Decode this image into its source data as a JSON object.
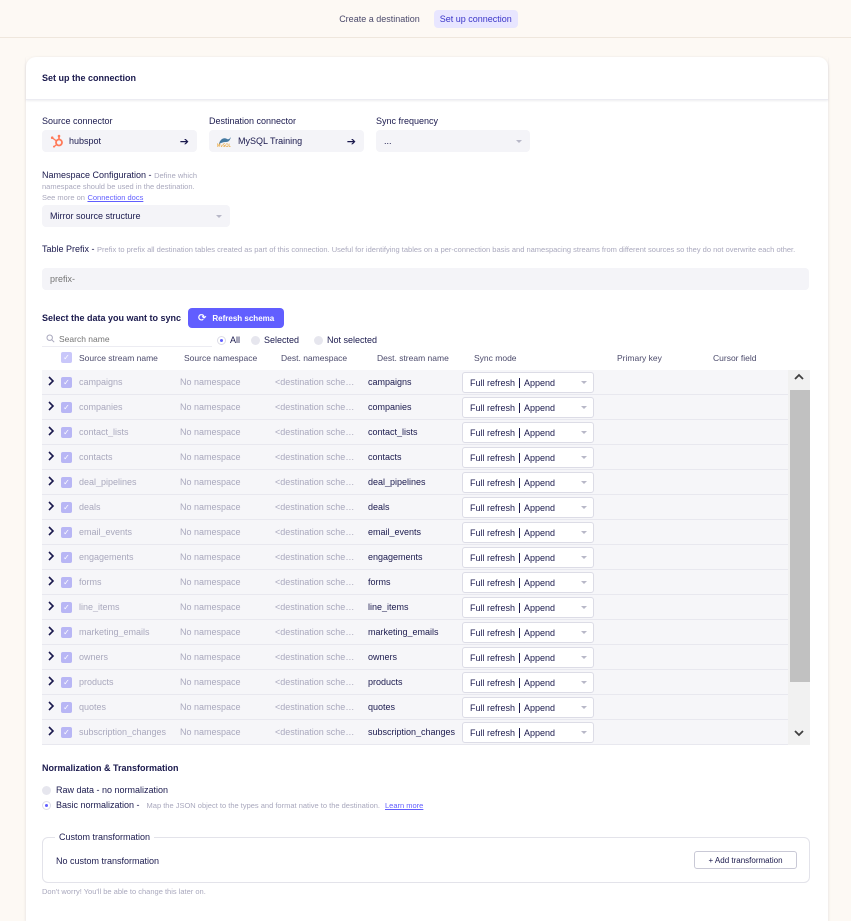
{
  "steps": [
    "Create a destination",
    "Set up connection"
  ],
  "header": {
    "title": "Set up the connection"
  },
  "source": {
    "label": "Source connector",
    "value": "hubspot"
  },
  "destination": {
    "label": "Destination connector",
    "value": "MySQL Training"
  },
  "sync": {
    "label": "Sync frequency",
    "value": "..."
  },
  "namespace": {
    "label": "Namespace Configuration -",
    "hint": "Define which namespace should be used in the destination.",
    "see_more": "See more on",
    "docs_link": "Connection docs",
    "value": "Mirror source structure"
  },
  "prefix": {
    "label": "Table Prefix -",
    "hint": "Prefix to prefix all destination tables created as part of this connection. Useful for identifying tables on a per-connection basis and namespacing streams from different sources so they do not overwrite each other.",
    "placeholder": "prefix-"
  },
  "select": {
    "title": "Select the data you want to sync",
    "refresh": "Refresh schema",
    "search_placeholder": "Search name",
    "filters": [
      "All",
      "Selected",
      "Not selected"
    ]
  },
  "columns": [
    "Source stream name",
    "Source namespace",
    "Dest. namespace",
    "Dest. stream name",
    "Sync mode",
    "Primary key",
    "Cursor field"
  ],
  "rows": [
    {
      "source": "campaigns",
      "ns": "No namespace",
      "dns": "<destination schema>",
      "dest": "campaigns",
      "mode_a": "Full refresh",
      "mode_b": "Append"
    },
    {
      "source": "companies",
      "ns": "No namespace",
      "dns": "<destination schema>",
      "dest": "companies",
      "mode_a": "Full refresh",
      "mode_b": "Append"
    },
    {
      "source": "contact_lists",
      "ns": "No namespace",
      "dns": "<destination schema>",
      "dest": "contact_lists",
      "mode_a": "Full refresh",
      "mode_b": "Append"
    },
    {
      "source": "contacts",
      "ns": "No namespace",
      "dns": "<destination schema>",
      "dest": "contacts",
      "mode_a": "Full refresh",
      "mode_b": "Append"
    },
    {
      "source": "deal_pipelines",
      "ns": "No namespace",
      "dns": "<destination schema>",
      "dest": "deal_pipelines",
      "mode_a": "Full refresh",
      "mode_b": "Append"
    },
    {
      "source": "deals",
      "ns": "No namespace",
      "dns": "<destination schema>",
      "dest": "deals",
      "mode_a": "Full refresh",
      "mode_b": "Append"
    },
    {
      "source": "email_events",
      "ns": "No namespace",
      "dns": "<destination schema>",
      "dest": "email_events",
      "mode_a": "Full refresh",
      "mode_b": "Append"
    },
    {
      "source": "engagements",
      "ns": "No namespace",
      "dns": "<destination schema>",
      "dest": "engagements",
      "mode_a": "Full refresh",
      "mode_b": "Append"
    },
    {
      "source": "forms",
      "ns": "No namespace",
      "dns": "<destination schema>",
      "dest": "forms",
      "mode_a": "Full refresh",
      "mode_b": "Append"
    },
    {
      "source": "line_items",
      "ns": "No namespace",
      "dns": "<destination schema>",
      "dest": "line_items",
      "mode_a": "Full refresh",
      "mode_b": "Append"
    },
    {
      "source": "marketing_emails",
      "ns": "No namespace",
      "dns": "<destination schema>",
      "dest": "marketing_emails",
      "mode_a": "Full refresh",
      "mode_b": "Append"
    },
    {
      "source": "owners",
      "ns": "No namespace",
      "dns": "<destination schema>",
      "dest": "owners",
      "mode_a": "Full refresh",
      "mode_b": "Append"
    },
    {
      "source": "products",
      "ns": "No namespace",
      "dns": "<destination schema>",
      "dest": "products",
      "mode_a": "Full refresh",
      "mode_b": "Append"
    },
    {
      "source": "quotes",
      "ns": "No namespace",
      "dns": "<destination schema>",
      "dest": "quotes",
      "mode_a": "Full refresh",
      "mode_b": "Append"
    },
    {
      "source": "subscription_changes",
      "ns": "No namespace",
      "dns": "<destination schema>",
      "dest": "subscription_changes",
      "mode_a": "Full refresh",
      "mode_b": "Append"
    }
  ],
  "normalization": {
    "title": "Normalization & Transformation",
    "raw": "Raw data - no normalization",
    "basic": "Basic normalization -",
    "basic_hint": "Map the JSON object to the types and format native to the destination.",
    "learn_more": "Learn more"
  },
  "custom": {
    "legend": "Custom transformation",
    "value": "No custom transformation",
    "add": "+ Add transformation"
  },
  "footer_note": "Don't worry! You'll be able to change this later on.",
  "colors": {
    "accent": "#615eff",
    "text": "#1a194d",
    "muted": "#a9a8bd",
    "hubspot": "#ff7a59"
  }
}
